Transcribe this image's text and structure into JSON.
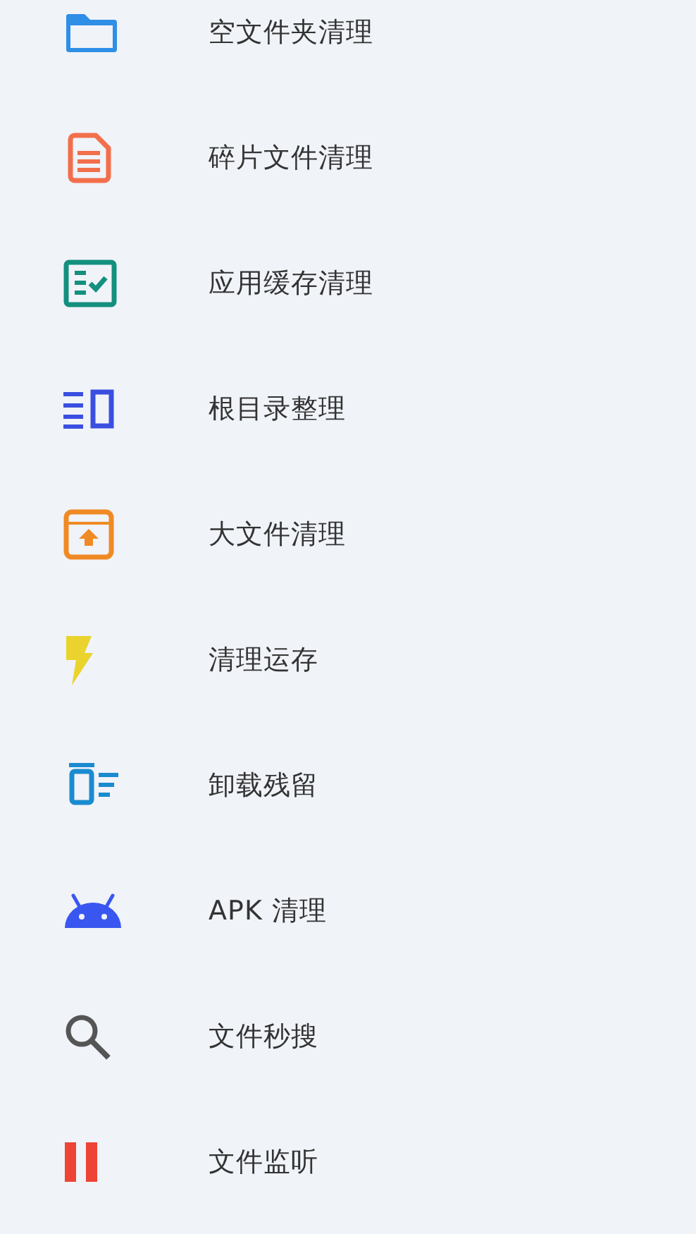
{
  "items": [
    {
      "kind": "folder",
      "label": "空文件夹清理"
    },
    {
      "kind": "document",
      "label": "碎片文件清理"
    },
    {
      "kind": "checklist",
      "label": "应用缓存清理"
    },
    {
      "kind": "list-panel",
      "label": "根目录整理"
    },
    {
      "kind": "archive",
      "label": "大文件清理"
    },
    {
      "kind": "bolt",
      "label": "清理运存"
    },
    {
      "kind": "trash",
      "label": "卸载残留"
    },
    {
      "kind": "android",
      "label": "APK 清理"
    },
    {
      "kind": "search",
      "label": "文件秒搜"
    },
    {
      "kind": "pause",
      "label": "文件监听"
    }
  ]
}
